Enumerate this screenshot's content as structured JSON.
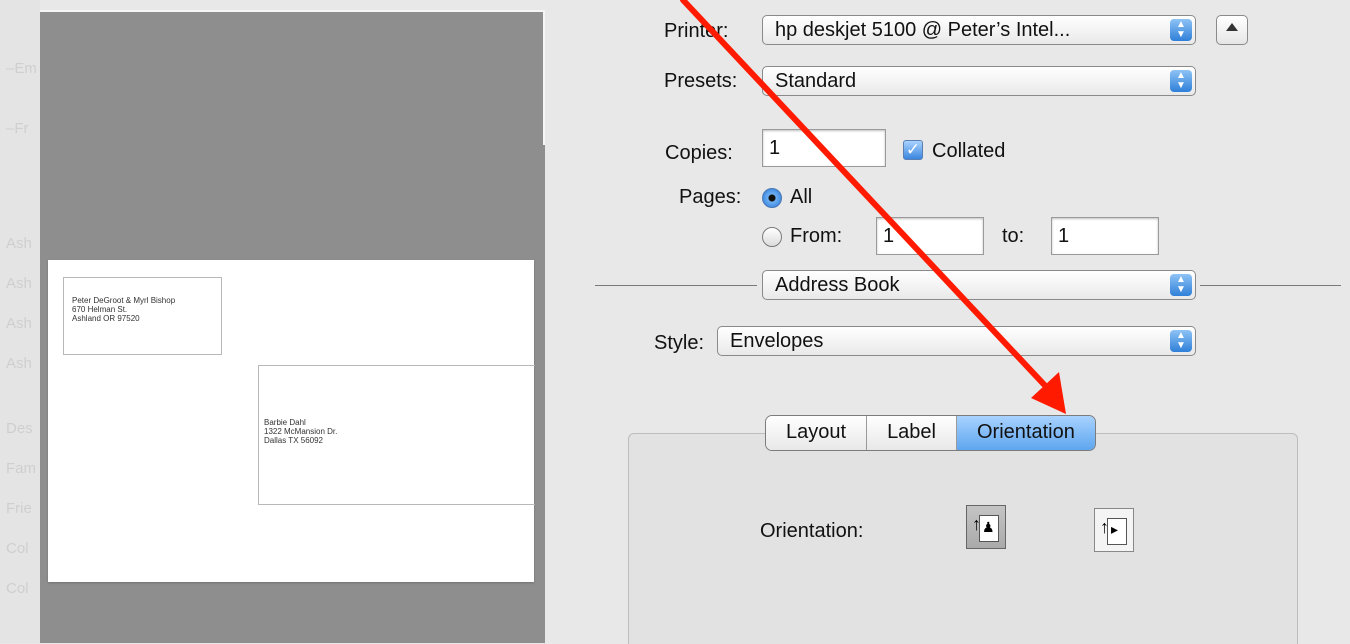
{
  "dialog": {
    "printer_label": "Printer:",
    "printer_value": "hp deskjet 5100 @ Peter’s Intel...",
    "presets_label": "Presets:",
    "presets_value": "Standard",
    "copies_label": "Copies:",
    "copies_value": "1",
    "collated_label": "Collated",
    "collated_checked": true,
    "pages_label": "Pages:",
    "pages_all_label": "All",
    "pages_from_label": "From:",
    "pages_from_value": "1",
    "pages_to_label": "to:",
    "pages_to_value": "1",
    "section_popup_value": "Address Book",
    "style_label": "Style:",
    "style_value": "Envelopes",
    "tabs": [
      {
        "label": "Layout",
        "selected": false
      },
      {
        "label": "Label",
        "selected": false
      },
      {
        "label": "Orientation",
        "selected": true
      }
    ],
    "orientation_label": "Orientation:",
    "orientation_options": [
      {
        "icon": "portrait-orientation-icon",
        "pressed": true
      },
      {
        "icon": "landscape-orientation-icon",
        "pressed": false
      }
    ]
  },
  "preview": {
    "return_address": [
      "Peter DeGroot & Myrl Bishop",
      "670 Helman St.",
      "Ashland OR 97520"
    ],
    "recipient_address": [
      "Barbie Dahl",
      "1322 McMansion Dr.",
      "Dallas TX 56092"
    ]
  },
  "annotation": {
    "color": "#ff1a00"
  },
  "colors": {
    "accent": "#3b86de",
    "preview_bg": "#8e8e8e"
  }
}
